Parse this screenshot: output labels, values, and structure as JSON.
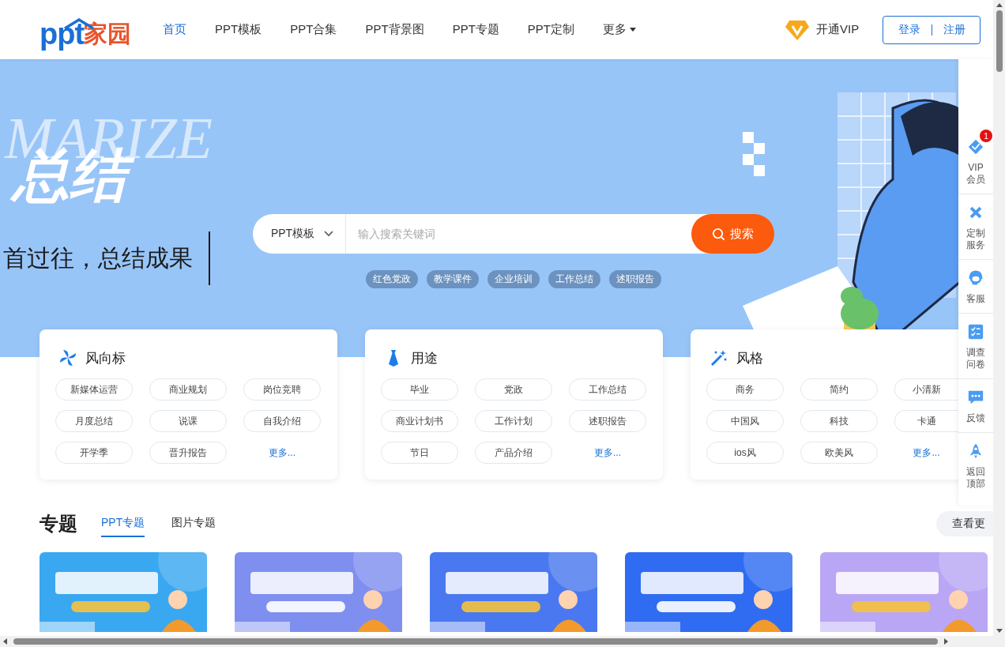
{
  "header": {
    "logo": {
      "latin": "ppt",
      "cjk": "家园"
    },
    "nav": [
      {
        "label": "首页",
        "selected": true,
        "dropdown": false
      },
      {
        "label": "PPT模板",
        "selected": false,
        "dropdown": false
      },
      {
        "label": "PPT合集",
        "selected": false,
        "dropdown": false
      },
      {
        "label": "PPT背景图",
        "selected": false,
        "dropdown": false
      },
      {
        "label": "PPT专题",
        "selected": false,
        "dropdown": false
      },
      {
        "label": "PPT定制",
        "selected": false,
        "dropdown": false
      },
      {
        "label": "更多",
        "selected": false,
        "dropdown": true
      }
    ],
    "vip": "开通VIP",
    "login": "登录",
    "register": "注册"
  },
  "hero": {
    "bg_word": "MARIZE",
    "title": "总结",
    "subtitle": "首过往，总结成果",
    "search": {
      "category": "PPT模板",
      "placeholder": "输入搜索关键词",
      "button": "搜索"
    },
    "hot_tags": [
      "红色党政",
      "教学课件",
      "企业培训",
      "工作总结",
      "述职报告"
    ]
  },
  "categories": [
    {
      "kind": "trend",
      "title": "风向标",
      "tags": [
        "新媒体运营",
        "商业规划",
        "岗位竞聘",
        "月度总结",
        "说课",
        "自我介绍",
        "开学季",
        "晋升报告"
      ],
      "more": "更多..."
    },
    {
      "kind": "usage",
      "title": "用途",
      "tags": [
        "毕业",
        "党政",
        "工作总结",
        "商业计划书",
        "工作计划",
        "述职报告",
        "节日",
        "产品介绍"
      ],
      "more": "更多..."
    },
    {
      "kind": "style",
      "title": "风格",
      "tags": [
        "商务",
        "简约",
        "小清新",
        "中国风",
        "科技",
        "卡通",
        "ios风",
        "欧美风"
      ],
      "more": "更多..."
    }
  ],
  "topics": {
    "title": "专题",
    "tabs": [
      {
        "label": "PPT专题",
        "selected": true
      },
      {
        "label": "图片专题",
        "selected": false
      }
    ],
    "view_more": "查看更"
  },
  "side_tools": [
    {
      "kind": "vip",
      "label": "VIP会员",
      "badge": "1"
    },
    {
      "kind": "custom",
      "label": "定制服务"
    },
    {
      "kind": "service",
      "label": "客服"
    },
    {
      "kind": "survey",
      "label": "调查问卷"
    },
    {
      "kind": "feedback",
      "label": "反馈"
    },
    {
      "kind": "top",
      "label": "返回顶部"
    }
  ]
}
